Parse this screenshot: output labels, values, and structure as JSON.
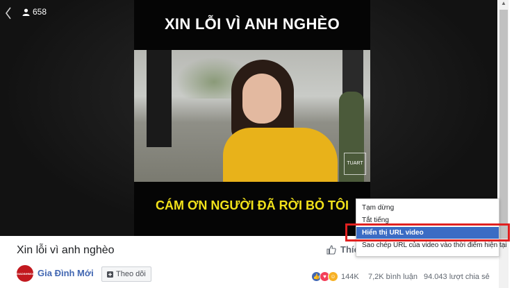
{
  "player": {
    "viewer_count": "658",
    "video_title_overlay": "XIN LỖI VÌ ANH NGHÈO",
    "video_caption": "CÁM ƠN NGƯỜI ĐÃ RỜI BỎ TÔI",
    "watermark": "TUART"
  },
  "info": {
    "title": "Xin lỗi vì anh nghèo",
    "like_label": "Thích",
    "page_name": "Gia Đình Mới",
    "follow_label": "Theo dõi",
    "reaction_count": "144K",
    "comments": "7,2K bình luận",
    "shares": "94.043 lượt chia sẻ"
  },
  "context_menu": {
    "items": [
      "Tạm dừng",
      "Tắt tiếng",
      "Hiển thị URL video",
      "Sao chép URL của video vào thời điểm hiện tại"
    ],
    "active_index": 2,
    "highlight_color": "#e02020",
    "active_color": "#3b6cc4"
  },
  "icons": {
    "back": "chevron-left-icon",
    "viewers": "person-icon",
    "like": "thumbs-up-icon",
    "follow": "plus-icon"
  }
}
